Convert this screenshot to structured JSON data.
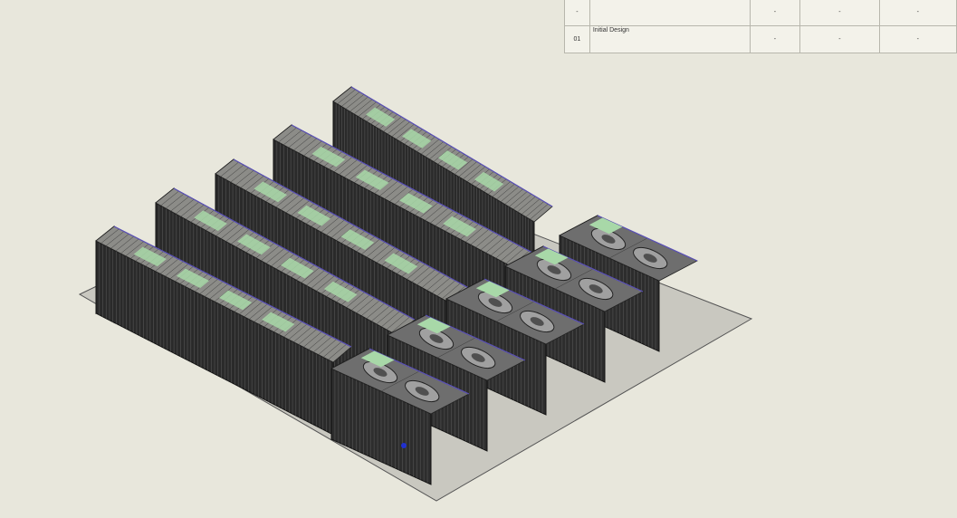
{
  "revision_table": {
    "rows": [
      {
        "rev": "-",
        "description": "",
        "c1": "-",
        "c2": "-",
        "c3": "-"
      },
      {
        "rev": "01",
        "description": "Initial Design",
        "c1": "-",
        "c2": "-",
        "c3": "-"
      }
    ]
  },
  "model": {
    "long_containers": 5,
    "cooling_modules": 5,
    "colors": {
      "background": "#e8e7dc",
      "base_plate": "#c9c8c0",
      "container_body": "#2a2a2a",
      "container_roof": "#8c8c88",
      "roof_vent": "#a8d8a8",
      "trim": "#5a50b8"
    }
  }
}
